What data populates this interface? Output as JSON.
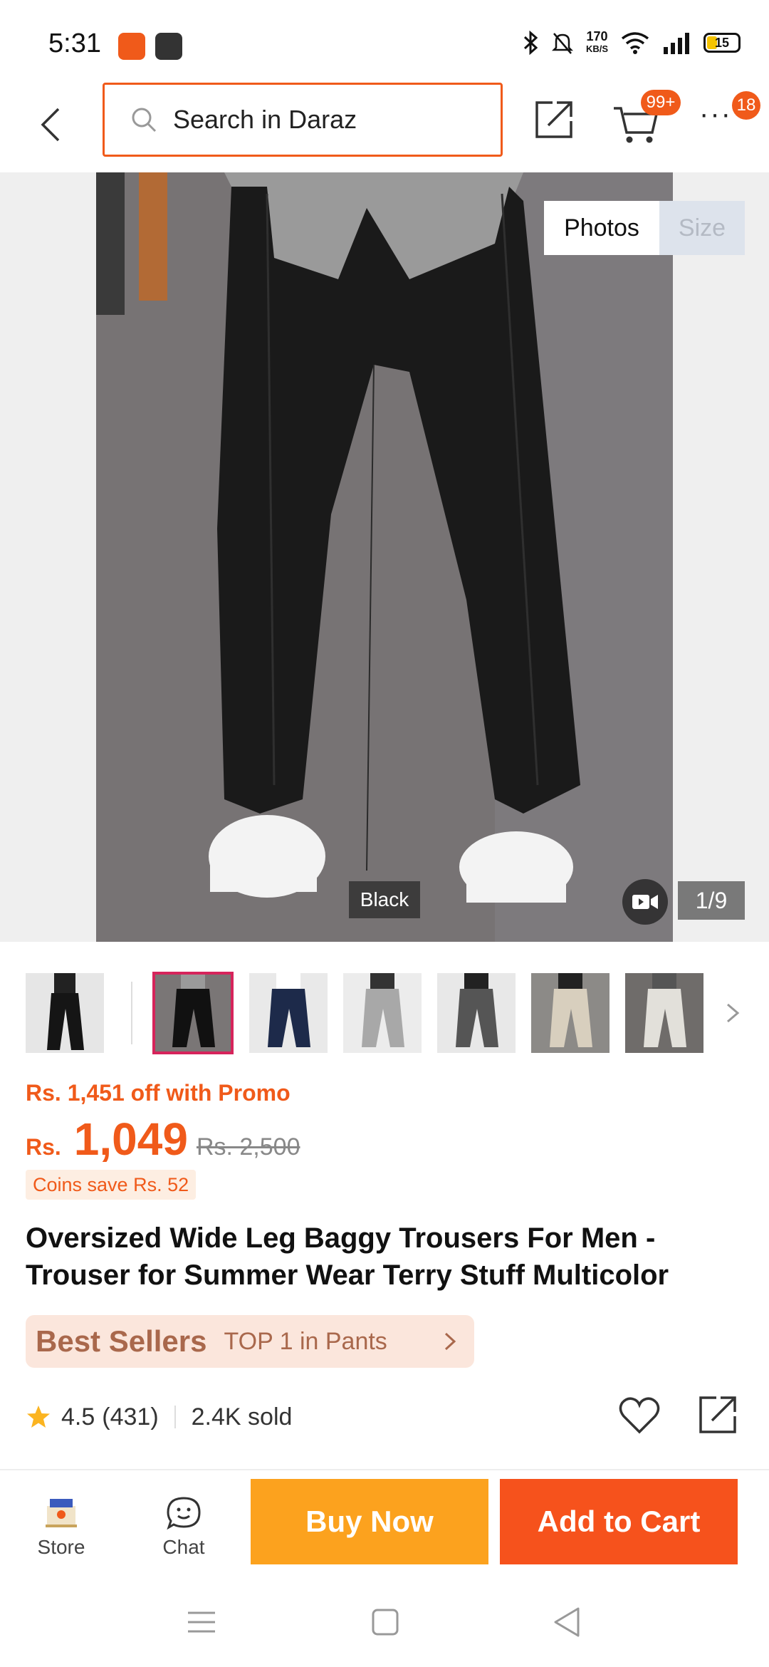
{
  "status_bar": {
    "time": "5:31",
    "net_speed_value": "170",
    "net_speed_unit": "KB/S",
    "battery": "15"
  },
  "header": {
    "search_placeholder": "Search in Daraz",
    "cart_badge": "99+",
    "more_badge": "18"
  },
  "gallery": {
    "tabs": [
      "Photos",
      "Size"
    ],
    "color_label": "Black",
    "counter": "1/9"
  },
  "product": {
    "promo_text": "Rs. 1,451 off with Promo",
    "currency": "Rs.",
    "price": "1,049",
    "old_price": "Rs. 2,500",
    "coins_text": "Coins save Rs. 52",
    "title": "Oversized Wide Leg Baggy Trousers For Men - Trouser for Summer Wear Terry Stuff Multicolor",
    "best_sellers_label": "Best Sellers",
    "best_sellers_text": "TOP 1 in Pants",
    "rating": "4.5",
    "reviews": "(431)",
    "sold": "2.4K sold"
  },
  "bottom_bar": {
    "store_label": "Store",
    "chat_label": "Chat",
    "buy_now": "Buy Now",
    "add_to_cart": "Add to Cart"
  },
  "colors": {
    "accent": "#f05a1a",
    "buy_now": "#fca21e",
    "add_to_cart": "#f6521c"
  }
}
